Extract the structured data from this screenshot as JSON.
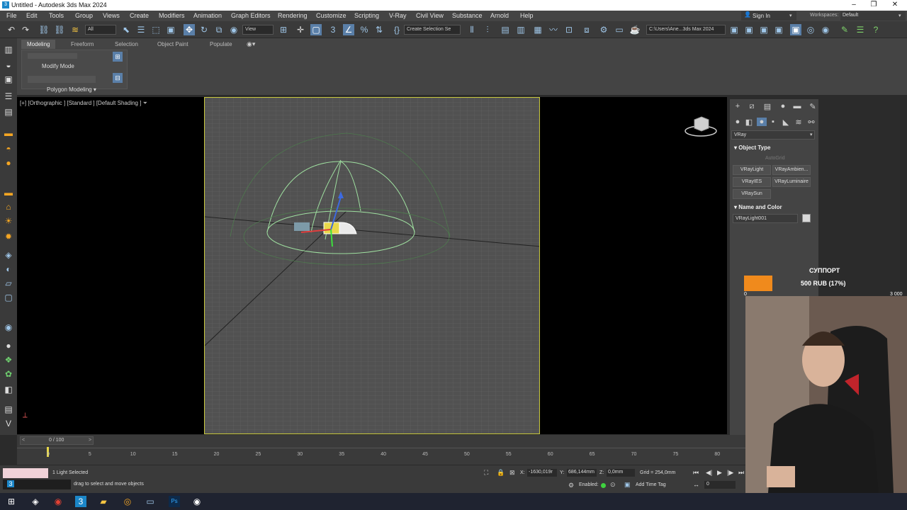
{
  "window": {
    "title": "Untitled - Autodesk 3ds Max 2024"
  },
  "menu": [
    "File",
    "Edit",
    "Tools",
    "Group",
    "Views",
    "Create",
    "Modifiers",
    "Animation",
    "Graph Editors",
    "Rendering",
    "Customize",
    "Scripting",
    "V-Ray",
    "Civil View",
    "Substance",
    "Arnold",
    "Help"
  ],
  "account": {
    "sign_in": "Sign In",
    "workspaces_label": "Workspaces:",
    "workspace": "Default"
  },
  "toolbar": {
    "selection_filter": "All",
    "reference_coord": "View",
    "named_selection": "Create Selection Se",
    "project_path": "C:\\Users\\Ane...3ds Max 2024"
  },
  "ribbon": {
    "tabs": [
      "Modeling",
      "Freeform",
      "Selection",
      "Object Paint",
      "Populate"
    ],
    "modify_mode": "Modify Mode",
    "polygon_modeling": "Polygon Modeling"
  },
  "viewport": {
    "label": "[+] [Orthographic ] [Standard ] [Default Shading ]"
  },
  "command_panel": {
    "category": "VRay",
    "object_type_title": "Object Type",
    "autogrid": "AutoGrid",
    "buttons": [
      "VRayLight",
      "VRayAmbien...",
      "VRayIES",
      "VRayLuminaire",
      "VRaySun"
    ],
    "name_color_title": "Name and Color",
    "object_name": "VRayLight001",
    "swatch_color": "#d8d8d8"
  },
  "timeline": {
    "frame_display": "0 / 100",
    "ticks": [
      "0",
      "5",
      "10",
      "15",
      "20",
      "25",
      "30",
      "35",
      "40",
      "45",
      "50",
      "55",
      "60",
      "65",
      "70",
      "75",
      "80"
    ]
  },
  "status": {
    "selection": "1 Light Selected",
    "prompt": "drag to select and move objects",
    "x_label": "X:",
    "x_value": "-1630,019r",
    "y_label": "Y:",
    "y_value": "686,144mm",
    "z_label": "Z:",
    "z_value": "0,0mm",
    "grid": "Grid = 254,0mm",
    "enabled": "Enabled:",
    "add_time_tag": "Add Time Tag",
    "frame": "0"
  },
  "donation": {
    "title": "СУППОРТ",
    "amount": "500 RUB (17%)",
    "min": "0",
    "max": "3 000",
    "progress": 0.17,
    "bar_color": "#f08a1c"
  }
}
